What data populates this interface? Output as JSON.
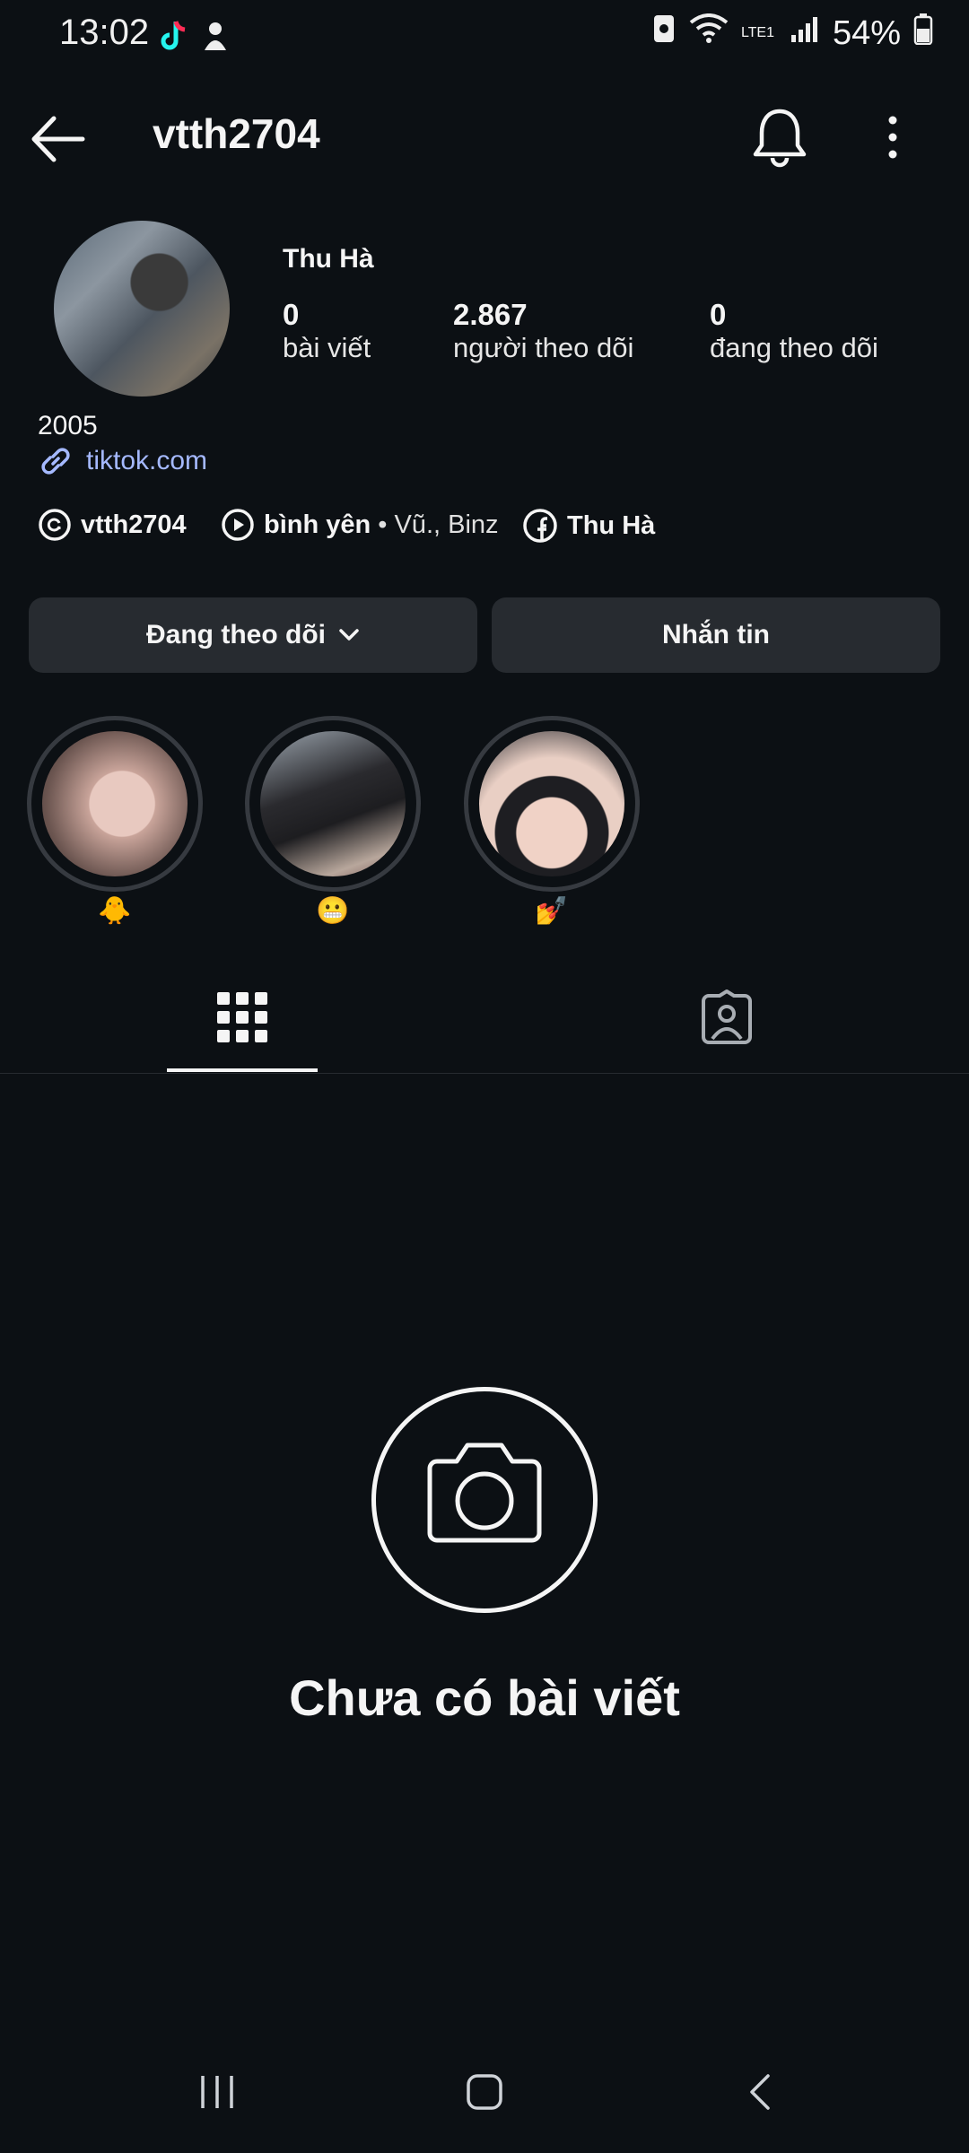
{
  "status": {
    "time": "13:02",
    "battery": "54%",
    "network": "LTE1"
  },
  "header": {
    "username": "vtth2704"
  },
  "profile": {
    "display_name": "Thu Hà",
    "stats": [
      {
        "value": "0",
        "label": "bài viết"
      },
      {
        "value": "2.867",
        "label": "người theo dõi"
      },
      {
        "value": "0",
        "label": "đang theo dõi"
      }
    ],
    "bio": "2005",
    "link": "tiktok.com"
  },
  "chips": {
    "threads": "vtth2704",
    "music_title": "bình yên",
    "music_artist": " • Vũ., Binz",
    "facebook": "Thu Hà"
  },
  "buttons": {
    "following": "Đang theo dõi",
    "message": "Nhắn tin"
  },
  "highlights": [
    {
      "label": "🐥"
    },
    {
      "label": "😬"
    },
    {
      "label": "💅"
    }
  ],
  "empty_state": {
    "text": "Chưa có bài viết"
  },
  "colors": {
    "background": "#0c1014",
    "button": "#272b30",
    "link": "#a5b9ff"
  }
}
